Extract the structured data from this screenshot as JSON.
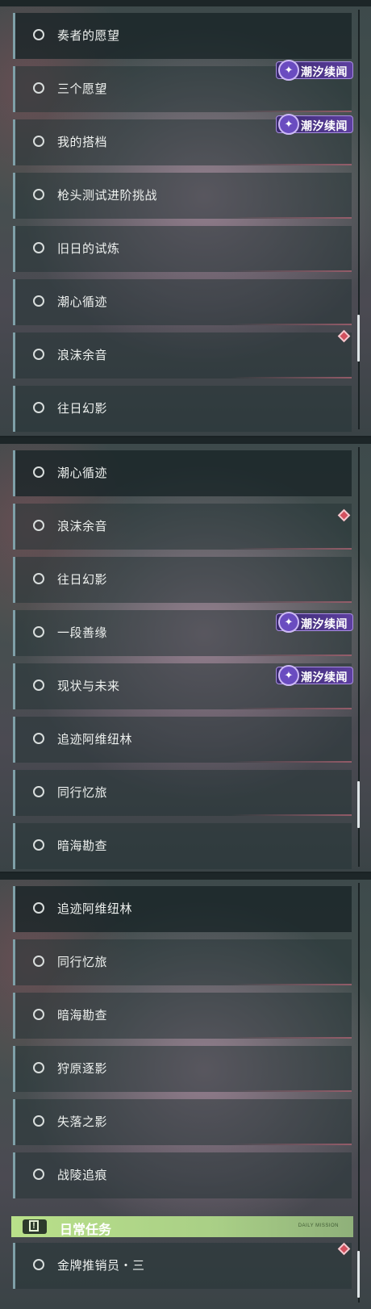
{
  "panels": [
    {
      "rows": [
        "奏者的愿望",
        "三个愿望",
        "我的搭档",
        "枪头测试进阶挑战",
        "旧日的试炼",
        "潮心循迹",
        "浪沫余音",
        "往日幻影"
      ]
    },
    {
      "rows": [
        "潮心循迹",
        "浪沫余音",
        "往日幻影",
        "一段善缘",
        "现状与未来",
        "追迹阿维纽林",
        "同行忆旅",
        "暗海勘查"
      ]
    },
    {
      "rows": [
        "追迹阿维纽林",
        "同行忆旅",
        "暗海勘查",
        "狩原逐影",
        "失落之影",
        "战陵追痕"
      ],
      "daily_section": {
        "title": "日常任务",
        "small_text": "DAILY MISSION",
        "rows": [
          "金牌推销员・三"
        ]
      }
    }
  ],
  "badge_label": "潮汐续闻",
  "colors": {
    "badge_bg": "#5d3fa0",
    "daily_bar": "#b9e08a",
    "diamond": "#d2505e",
    "row_accent_left": "#7fa0a8"
  },
  "icons": {
    "row": "circle-unchecked-icon",
    "badge": "tide-sparkle-icon",
    "marker": "red-diamond-icon",
    "daily": "alert-box-icon"
  }
}
